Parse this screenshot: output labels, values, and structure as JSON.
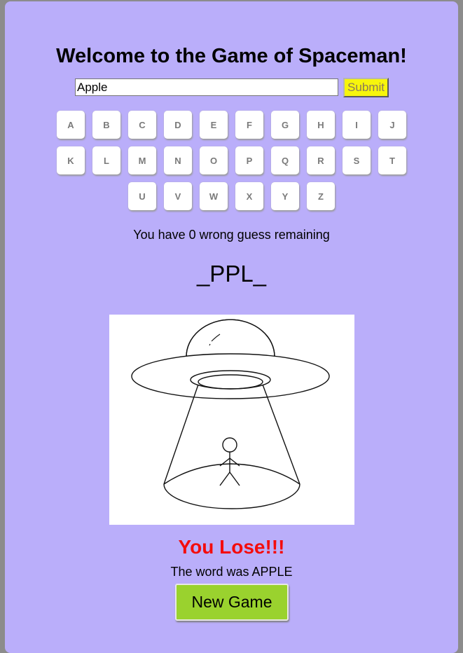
{
  "header": {
    "title": "Welcome to the Game of Spaceman!"
  },
  "guess_form": {
    "input_value": "Apple",
    "submit_label": "Submit"
  },
  "letters": {
    "rows": [
      [
        "A",
        "B",
        "C",
        "D",
        "E",
        "F",
        "G",
        "H",
        "I",
        "J"
      ],
      [
        "K",
        "L",
        "M",
        "N",
        "O",
        "P",
        "Q",
        "R",
        "S",
        "T"
      ],
      [
        "U",
        "V",
        "W",
        "X",
        "Y",
        "Z"
      ]
    ]
  },
  "status": {
    "remaining_text": "You have 0 wrong guess remaining",
    "word_display": "_PPL_"
  },
  "illustration": {
    "icon": "ufo-abduction-icon"
  },
  "result": {
    "message": "You Lose!!!",
    "answer_text": "The word was APPLE",
    "new_game_label": "New Game"
  },
  "colors": {
    "background": "#baaefa",
    "submit": "#f7f50c",
    "lose": "#f40c0c",
    "new_game": "#9ad22e"
  }
}
